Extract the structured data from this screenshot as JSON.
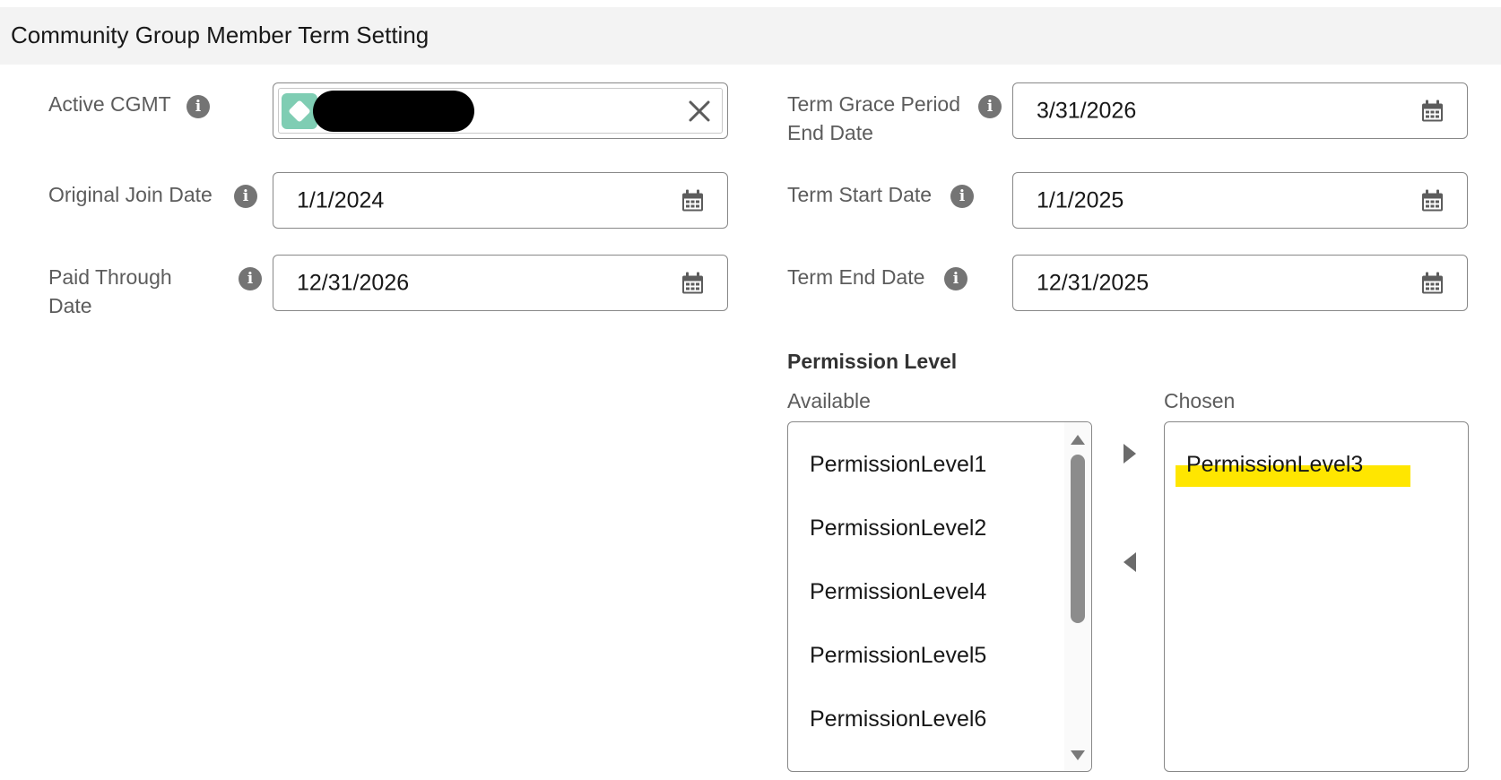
{
  "section": {
    "title": "Community Group Member Term Setting"
  },
  "fields": {
    "active_cgmt": {
      "label": "Active CGMT"
    },
    "original_join_date": {
      "label": "Original Join Date",
      "value": "1/1/2024"
    },
    "paid_through_date": {
      "label_line1": "Paid Through",
      "label_line2": "Date",
      "value": "12/31/2026"
    },
    "term_grace_period_end_date": {
      "label_line1": "Term Grace Period",
      "label_line2": "End Date",
      "value": "3/31/2026"
    },
    "term_start_date": {
      "label": "Term Start Date",
      "value": "1/1/2025"
    },
    "term_end_date": {
      "label": "Term End Date",
      "value": "12/31/2025"
    }
  },
  "permission_level": {
    "title": "Permission Level",
    "available_label": "Available",
    "chosen_label": "Chosen",
    "available": [
      "PermissionLevel1",
      "PermissionLevel2",
      "PermissionLevel4",
      "PermissionLevel5",
      "PermissionLevel6"
    ],
    "chosen": [
      "PermissionLevel3"
    ]
  },
  "icons": {
    "info": "info-icon",
    "calendar": "calendar-icon",
    "clear": "close-icon",
    "move_right": "arrow-right-icon",
    "move_left": "arrow-left-icon"
  },
  "colors": {
    "header_bg": "#f3f3f3",
    "avatar": "#7fcdb3",
    "highlight": "#ffe600",
    "icon_gray": "#747474"
  }
}
